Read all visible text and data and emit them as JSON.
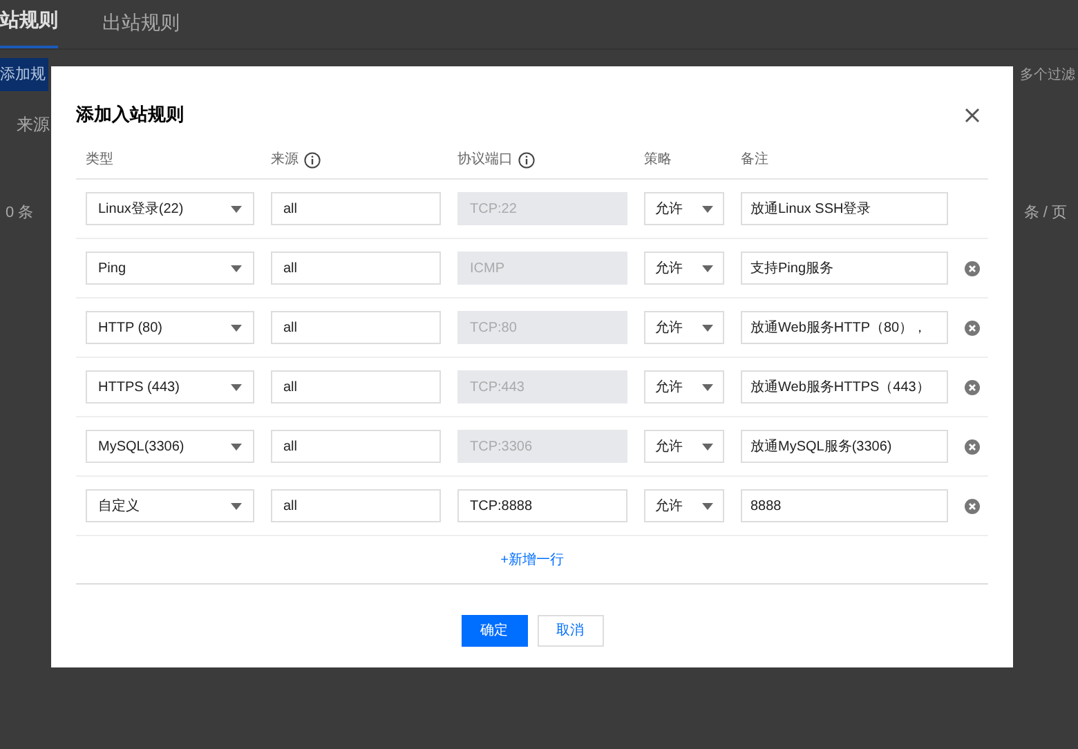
{
  "background": {
    "tabs": [
      {
        "label": "站规则",
        "selected": true
      },
      {
        "label": "出站规则",
        "selected": false
      }
    ],
    "add_button": "添加规",
    "filter_label": "来源",
    "filter_hint": "多个过滤",
    "count": "0 条",
    "page_size": "条 / 页"
  },
  "dialog": {
    "title": "添加入站规则",
    "columns": [
      {
        "label": "类型",
        "info": false
      },
      {
        "label": "来源",
        "info": true
      },
      {
        "label": "协议端口",
        "info": true
      },
      {
        "label": "策略",
        "info": false
      },
      {
        "label": "备注",
        "info": false
      }
    ],
    "rows": [
      {
        "type": "Linux登录(22)",
        "source": "all",
        "port": "TCP:22",
        "port_disabled": true,
        "policy": "允许",
        "note": "放通Linux SSH登录",
        "removable": false
      },
      {
        "type": "Ping",
        "source": "all",
        "port": "ICMP",
        "port_disabled": true,
        "policy": "允许",
        "note": "支持Ping服务",
        "removable": true
      },
      {
        "type": "HTTP (80)",
        "source": "all",
        "port": "TCP:80",
        "port_disabled": true,
        "policy": "允许",
        "note": "放通Web服务HTTP（80），",
        "removable": true
      },
      {
        "type": "HTTPS (443)",
        "source": "all",
        "port": "TCP:443",
        "port_disabled": true,
        "policy": "允许",
        "note": "放通Web服务HTTPS（443）",
        "removable": true
      },
      {
        "type": "MySQL(3306)",
        "source": "all",
        "port": "TCP:3306",
        "port_disabled": true,
        "policy": "允许",
        "note": "放通MySQL服务(3306)",
        "removable": true
      },
      {
        "type": "自定义",
        "source": "all",
        "port": "TCP:8888",
        "port_disabled": false,
        "policy": "允许",
        "note": "8888",
        "removable": true
      }
    ],
    "add_row": "+新增一行",
    "confirm": "确定",
    "cancel": "取消"
  }
}
